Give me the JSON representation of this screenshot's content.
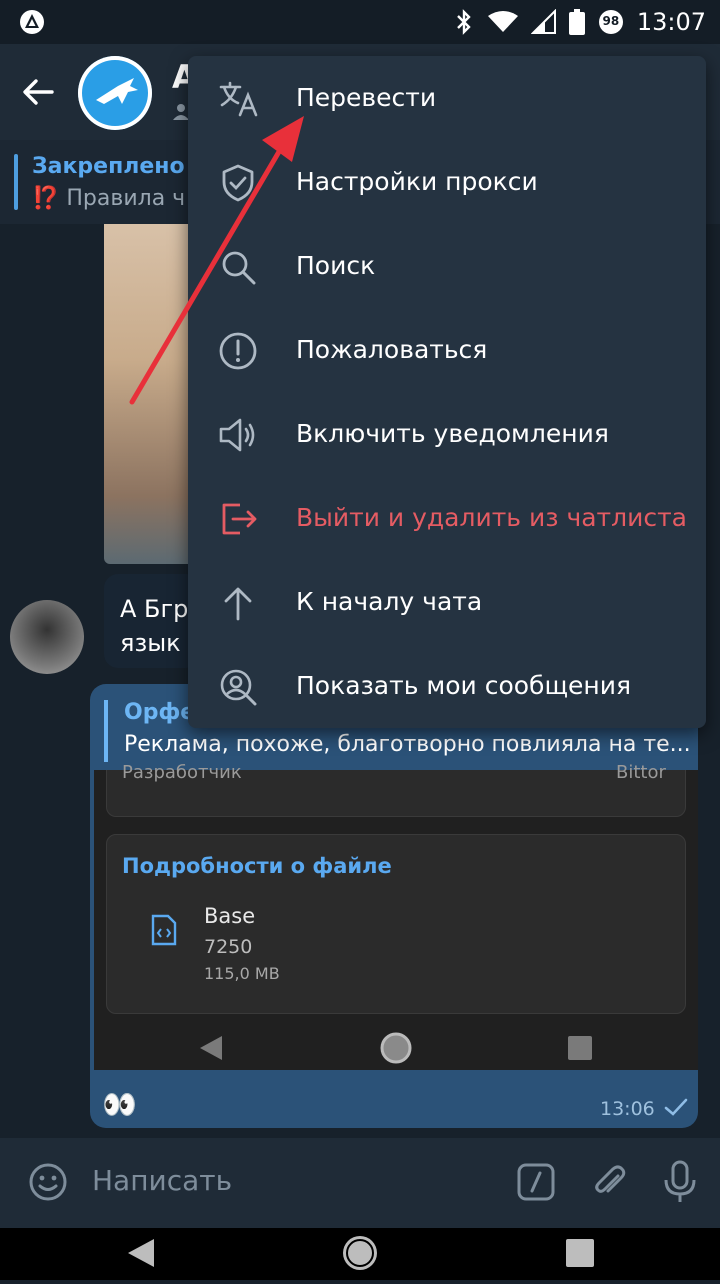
{
  "status_bar": {
    "time": "13:07",
    "battery": "98"
  },
  "header": {
    "title_initial": "А"
  },
  "pinned": {
    "title": "Закреплено",
    "text": "⁉️ Правила ч"
  },
  "messages": {
    "incoming_text_line1": "А Бгр",
    "incoming_text_line2": "язык",
    "outgoing": {
      "reply_name": "Орфе",
      "reply_text": "Реклама, похоже, благотворно повлияла на те...",
      "screenshot": {
        "developer_label": "Разработчик",
        "developer_value": "Bittor",
        "details_title": "Подробности о файле",
        "file_name": "Base",
        "file_build": "7250",
        "file_size": "115,0 MB"
      },
      "emoji": "👀",
      "time": "13:06"
    }
  },
  "composer": {
    "placeholder": "Написать"
  },
  "menu": {
    "items": [
      {
        "label": "Перевести",
        "icon": "translate-icon"
      },
      {
        "label": "Настройки прокси",
        "icon": "shield-icon"
      },
      {
        "label": "Поиск",
        "icon": "search-icon"
      },
      {
        "label": "Пожаловаться",
        "icon": "report-icon"
      },
      {
        "label": "Включить уведомления",
        "icon": "speaker-icon"
      },
      {
        "label": "Выйти и удалить из чатлиста",
        "icon": "leave-icon"
      },
      {
        "label": "К началу чата",
        "icon": "arrow-up-icon"
      },
      {
        "label": "Показать мои сообщения",
        "icon": "user-search-icon"
      }
    ]
  },
  "colors": {
    "accent": "#5aa9f0",
    "danger": "#e55c63",
    "menu_bg": "#253341",
    "annotation_arrow": "#e8303a"
  }
}
